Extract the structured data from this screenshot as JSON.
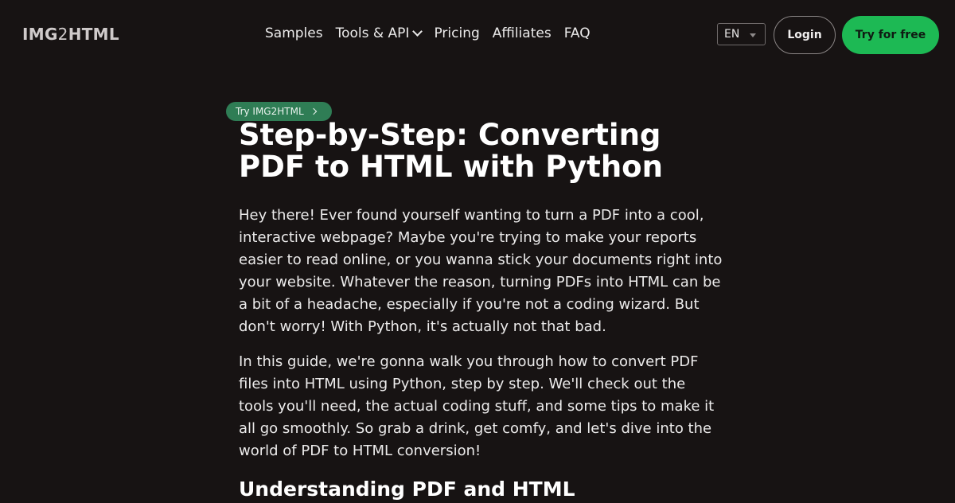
{
  "header": {
    "logo": {
      "part1": "IMG",
      "part2": "2",
      "part3": "HTML"
    },
    "nav": [
      {
        "label": "Samples"
      },
      {
        "label": "Tools & API",
        "has_dropdown": true
      },
      {
        "label": "Pricing"
      },
      {
        "label": "Affiliates"
      },
      {
        "label": "FAQ"
      }
    ],
    "language": "EN",
    "login_label": "Login",
    "cta_label": "Try for free"
  },
  "badge": {
    "label": "Try IMG2HTML"
  },
  "article": {
    "title": "Step-by-Step: Converting PDF to HTML with Python",
    "paragraphs": [
      "Hey there! Ever found yourself wanting to turn a PDF into a cool, interactive webpage? Maybe you're trying to make your reports easier to read online, or you wanna stick your documents right into your website. Whatever the reason, turning PDFs into HTML can be a bit of a headache, especially if you're not a coding wizard. But don't worry! With Python, it's actually not that bad.",
      "In this guide, we're gonna walk you through how to convert PDF files into HTML using Python, step by step. We'll check out the tools you'll need, the actual coding stuff, and some tips to make it all go smoothly. So grab a drink, get comfy, and let's dive into the world of PDF to HTML conversion!"
    ],
    "section_heading": "Understanding PDF and HTML"
  },
  "colors": {
    "background": "#171313",
    "accent_green": "#1db954",
    "badge_green": "#2f7d55"
  },
  "icons": {
    "nav_dropdown": "chevron-down-icon",
    "lang_dropdown": "caret-down-icon",
    "badge_arrow": "chevron-right-icon"
  }
}
